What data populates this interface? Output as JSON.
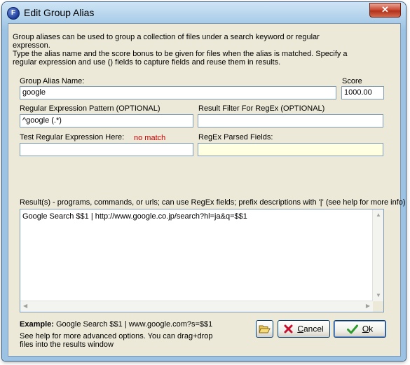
{
  "window": {
    "title": "Edit Group Alias",
    "app_icon_letter": "F",
    "close_label": "✕"
  },
  "intro": {
    "line1": "Group aliases can be used to group a collection of files under a search keyword or regular",
    "line2": "expresson.",
    "line3": "Type the alias name and the score bonus to be given for files when the alias is matched.  Specify a",
    "line4": "regular expression and use () fields to capture fields and reuse them in results."
  },
  "alias_name": {
    "label": "Group Alias Name:",
    "value": "google"
  },
  "score": {
    "label": "Score",
    "value": "1000.00"
  },
  "regex_pattern": {
    "label": "Regular Expression Pattern (OPTIONAL)",
    "value": "^google (.*)"
  },
  "result_filter": {
    "label": "Result Filter For RegEx (OPTIONAL)",
    "value": ""
  },
  "test_regex": {
    "label": "Test Regular Expression Here:",
    "value": "",
    "status": "no match"
  },
  "parsed_fields": {
    "label": "RegEx Parsed Fields:",
    "value": ""
  },
  "results": {
    "label": "Result(s) - programs, commands, or urls; can use RegEx fields; prefix descriptions with '|' (see help for more info)",
    "value": "Google Search $$1 | http://www.google.co.jp/search?hl=ja&q=$$1"
  },
  "example": {
    "prefix": "Example:",
    "text": "Google Search $$1 | www.google.com?s=$$1"
  },
  "help": {
    "line1": "See help for more advanced options.  You can drag+drop",
    "line2": "files into the results window"
  },
  "buttons": {
    "cancel_accel": "C",
    "cancel_rest": "ancel",
    "ok_accel": "O",
    "ok_rest": "k"
  },
  "colors": {
    "nomatch": "#c80000",
    "readonly_bg": "#ffffe1",
    "ok_check": "#2e9b2e",
    "cancel_x": "#c8102e"
  }
}
